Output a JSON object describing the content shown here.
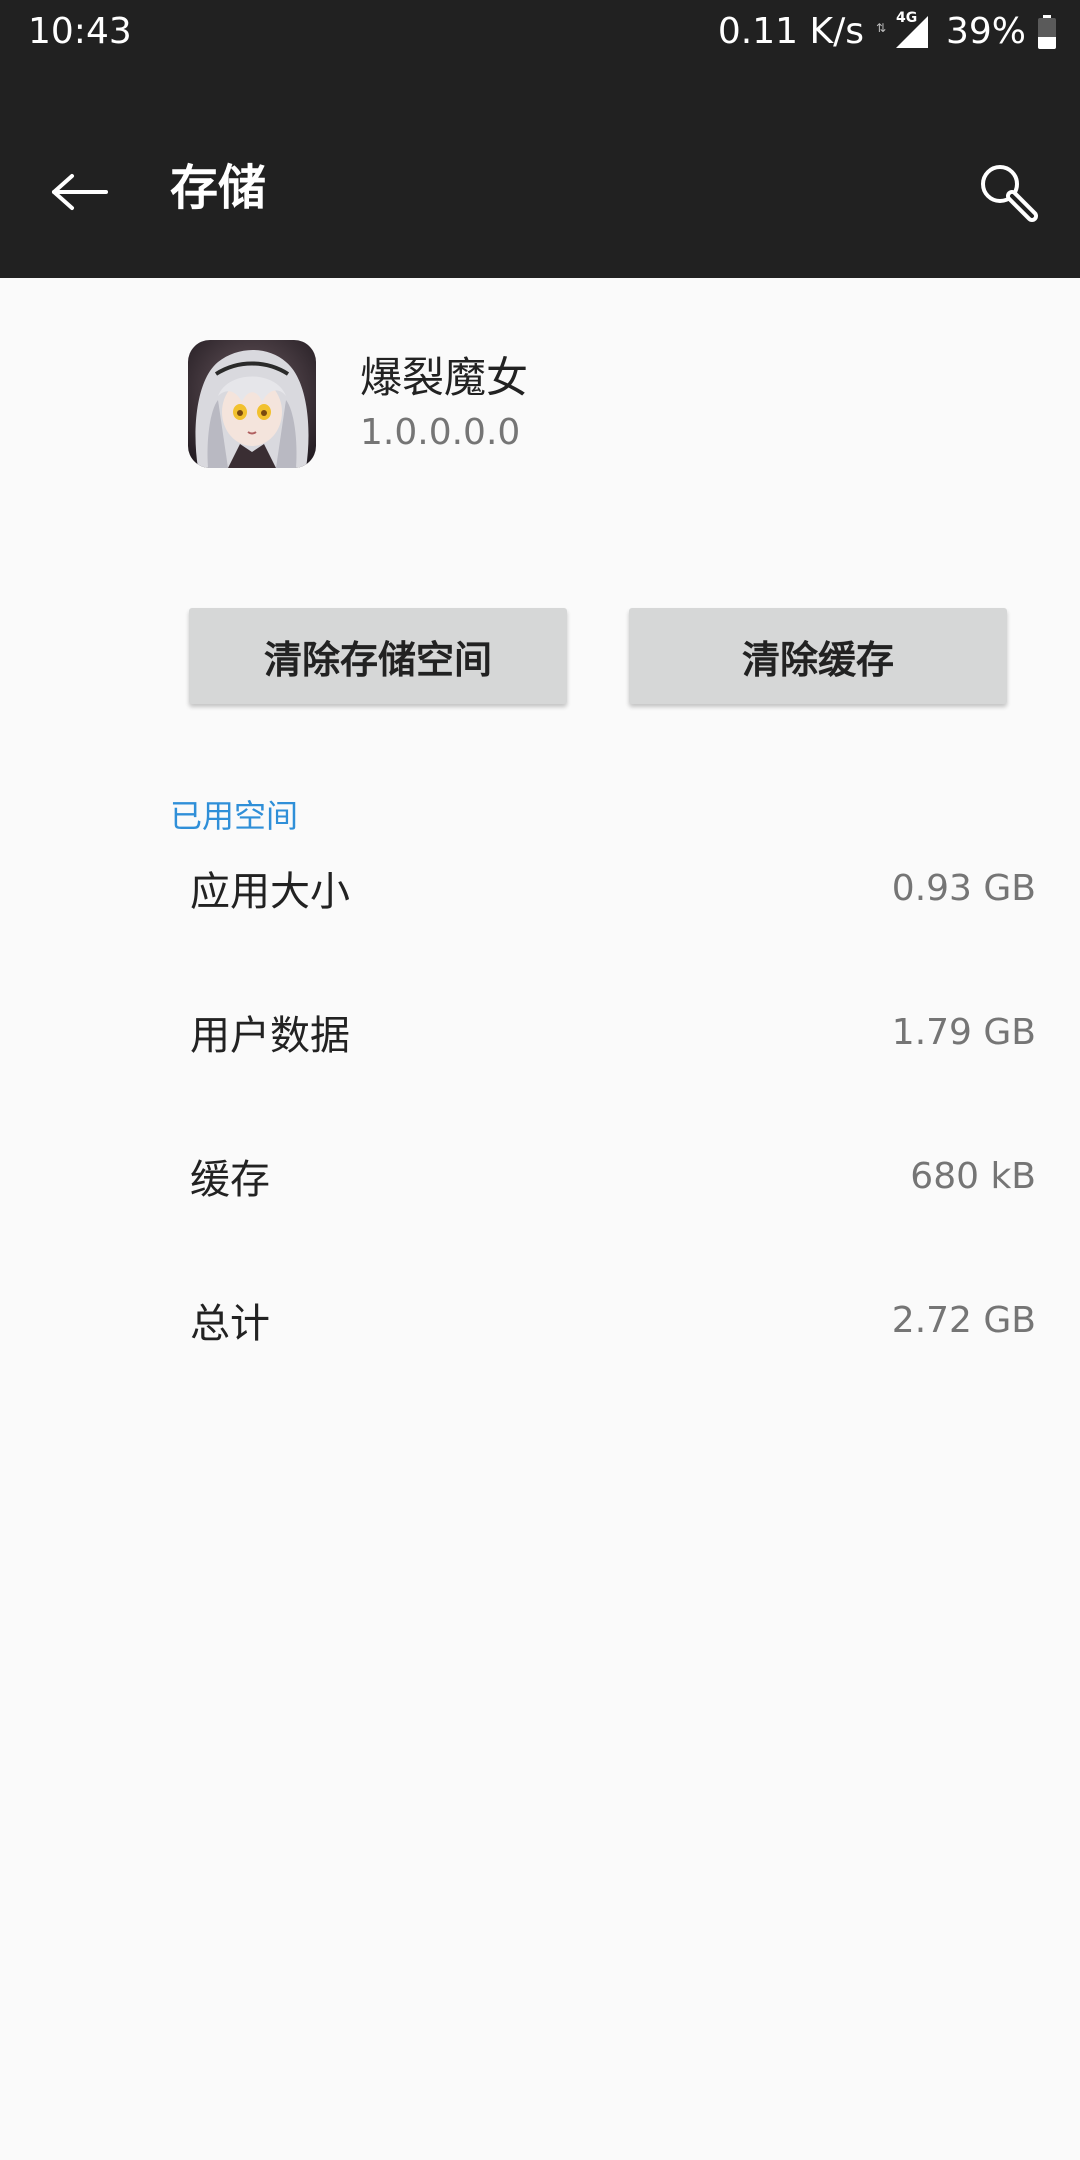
{
  "status_bar": {
    "time": "10:43",
    "net_speed": "0.11 K/s",
    "network_type": "4G",
    "battery_percent": "39%",
    "battery_level": 0.39
  },
  "toolbar": {
    "title": "存储",
    "back_icon": "arrow-left-icon",
    "search_icon": "search-icon"
  },
  "app": {
    "name": "爆裂魔女",
    "version": "1.0.0.0.0"
  },
  "buttons": {
    "clear_storage": "清除存储空间",
    "clear_cache": "清除缓存"
  },
  "storage": {
    "section_title": "已用空间",
    "rows": [
      {
        "label": "应用大小",
        "value": "0.93 GB"
      },
      {
        "label": "用户数据",
        "value": "1.79 GB"
      },
      {
        "label": "缓存",
        "value": "680 kB"
      },
      {
        "label": "总计",
        "value": "2.72 GB"
      }
    ]
  },
  "colors": {
    "toolbar_bg": "#212121",
    "page_bg": "#fafafa",
    "accent": "#2f8fd8",
    "button_bg": "#d6d7d7"
  }
}
